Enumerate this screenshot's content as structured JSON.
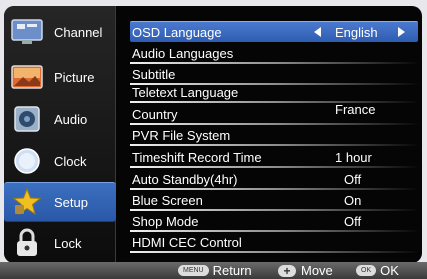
{
  "sidebar": {
    "items": [
      {
        "label": "Channel",
        "icon": "channel-icon"
      },
      {
        "label": "Picture",
        "icon": "picture-icon"
      },
      {
        "label": "Audio",
        "icon": "audio-icon"
      },
      {
        "label": "Clock",
        "icon": "clock-icon"
      },
      {
        "label": "Setup",
        "icon": "setup-icon",
        "active": true
      },
      {
        "label": "Lock",
        "icon": "lock-icon"
      }
    ]
  },
  "menu": {
    "items": [
      {
        "label": "OSD Language",
        "value": "English",
        "selected": true
      },
      {
        "label": "Audio Languages",
        "value": ""
      },
      {
        "label": "Subtitle",
        "value": ""
      },
      {
        "label": "Teletext Language",
        "value": ""
      },
      {
        "label": "Country",
        "value": "France"
      },
      {
        "label": "PVR File System",
        "value": ""
      },
      {
        "label": "Timeshift Record Time",
        "value": "1 hour"
      },
      {
        "label": "Auto Standby(4hr)",
        "value": "Off"
      },
      {
        "label": "Blue Screen",
        "value": "On"
      },
      {
        "label": "Shop Mode",
        "value": "Off"
      },
      {
        "label": "HDMI CEC Control",
        "value": ""
      }
    ]
  },
  "footer": {
    "return_key": "MENU",
    "return_label": "Return",
    "move_key": "+",
    "move_label": "Move",
    "ok_key": "OK",
    "ok_label": "OK"
  },
  "colors": {
    "accent": "#3a6cc0",
    "background": "#050505"
  }
}
